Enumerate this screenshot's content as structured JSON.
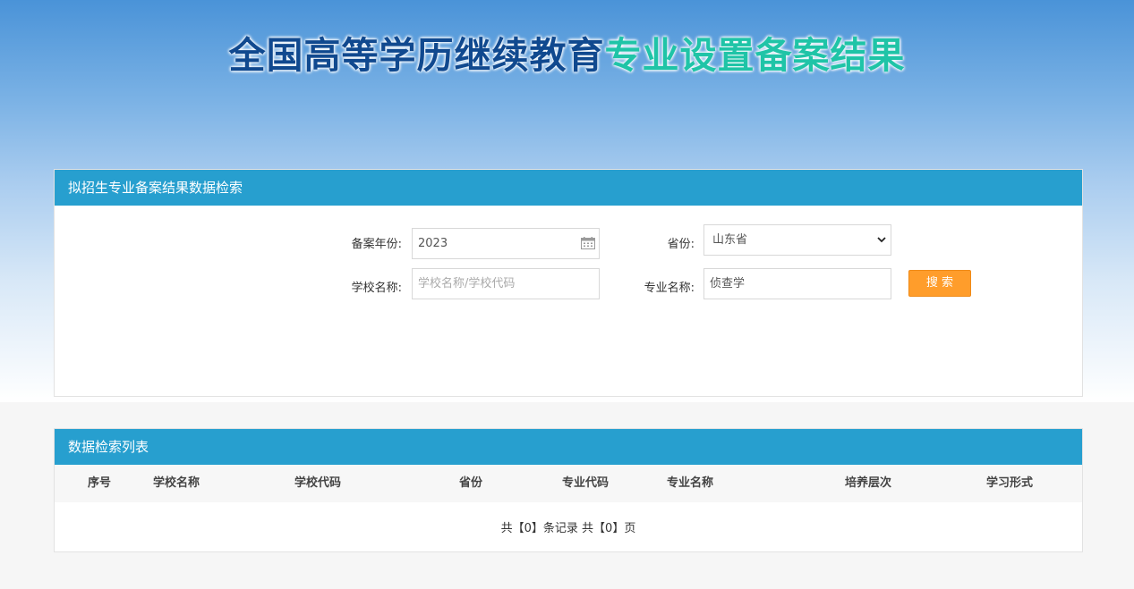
{
  "page": {
    "title_part1": "全国高等学历继续教育",
    "title_part2": "专业设置备案结果"
  },
  "search_panel": {
    "header": "拟招生专业备案结果数据检索",
    "year_label": "备案年份:",
    "year_value": "2023",
    "province_label": "省份:",
    "province_value": "山东省",
    "school_label": "学校名称:",
    "school_placeholder": "学校名称/学校代码",
    "major_label": "专业名称:",
    "major_value": "侦查学",
    "search_button": "搜 索"
  },
  "list_panel": {
    "header": "数据检索列表",
    "columns": [
      "序号",
      "学校名称",
      "学校代码",
      "省份",
      "专业代码",
      "专业名称",
      "培养层次",
      "学习形式"
    ],
    "summary": "共【0】条记录 共【0】页"
  },
  "icons": {
    "calendar": "calendar-icon",
    "dropdown": "chevron-down-icon"
  },
  "colors": {
    "header_bar": "#279fcf",
    "title_dark": "#10498f",
    "title_accent": "#1fc4a7",
    "search_button": "#ff9d2b"
  }
}
